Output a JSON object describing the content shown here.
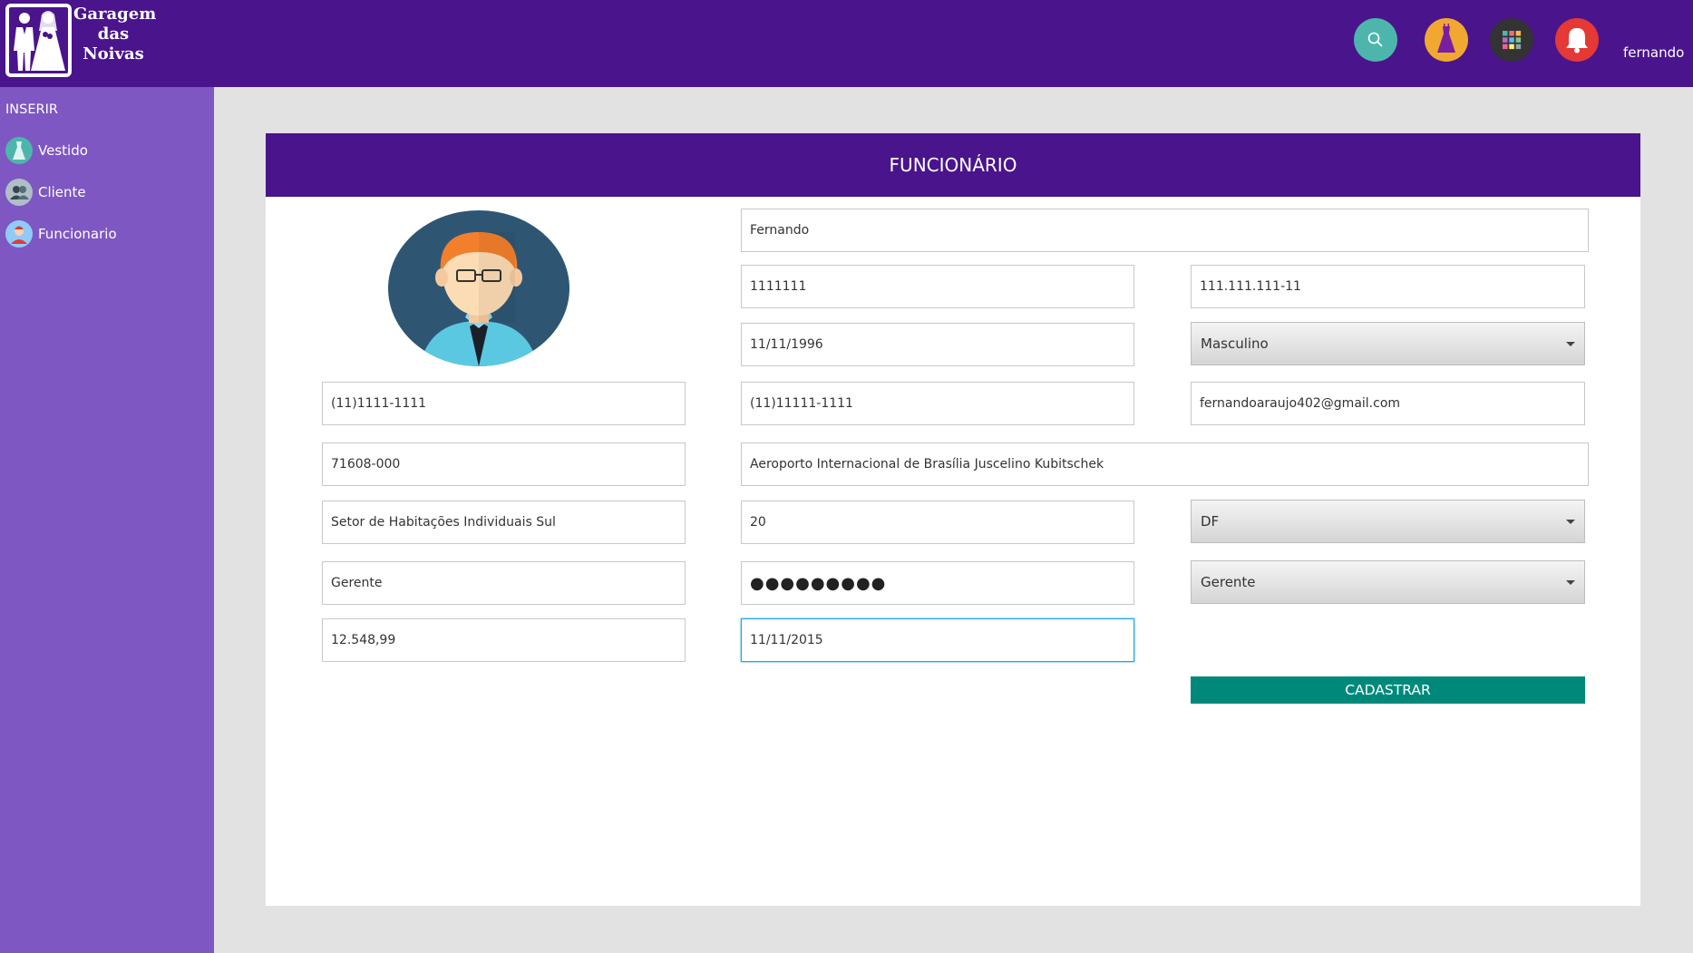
{
  "header": {
    "logo_text_line1": "Garagem",
    "logo_text_line2": "das",
    "logo_text_line3": "Noivas",
    "icons": [
      {
        "name": "search-icon",
        "color": "#4db6ac"
      },
      {
        "name": "dress-icon",
        "color": "#f0a830"
      },
      {
        "name": "apps-grid-icon",
        "color": "#333333"
      },
      {
        "name": "bell-icon",
        "color": "#e53935"
      }
    ],
    "username": "fernando"
  },
  "sidebar": {
    "title": "INSERIR",
    "items": [
      {
        "label": "Vestido",
        "icon": "dress-icon"
      },
      {
        "label": "Cliente",
        "icon": "users-icon"
      },
      {
        "label": "Funcionario",
        "icon": "employee-icon"
      }
    ]
  },
  "form": {
    "title": "FUNCIONÁRIO",
    "nome": "Fernando",
    "rg": "1111111",
    "cpf": "111.111.111-11",
    "nascimento": "11/11/1996",
    "sexo": "Masculino",
    "telefone": "(11)1111-1111",
    "celular": "(11)11111-1111",
    "email": "fernandoaraujo402@gmail.com",
    "cep": "71608-000",
    "endereco": "Aeroporto Internacional de Brasília Juscelino Kubitschek",
    "bairro": "Setor de Habitações Individuais Sul",
    "numero": "20",
    "uf": "DF",
    "cargo": "Gerente",
    "senha": "●●●●●●●●●",
    "nivel": "Gerente",
    "salario": "12.548,99",
    "admissao": "11/11/2015",
    "submit_label": "CADASTRAR"
  },
  "colors": {
    "header_bg": "#4a148c",
    "sidebar_bg": "#7e57c2",
    "submit_bg": "#00897b",
    "focus_border": "#1aa7e0"
  }
}
